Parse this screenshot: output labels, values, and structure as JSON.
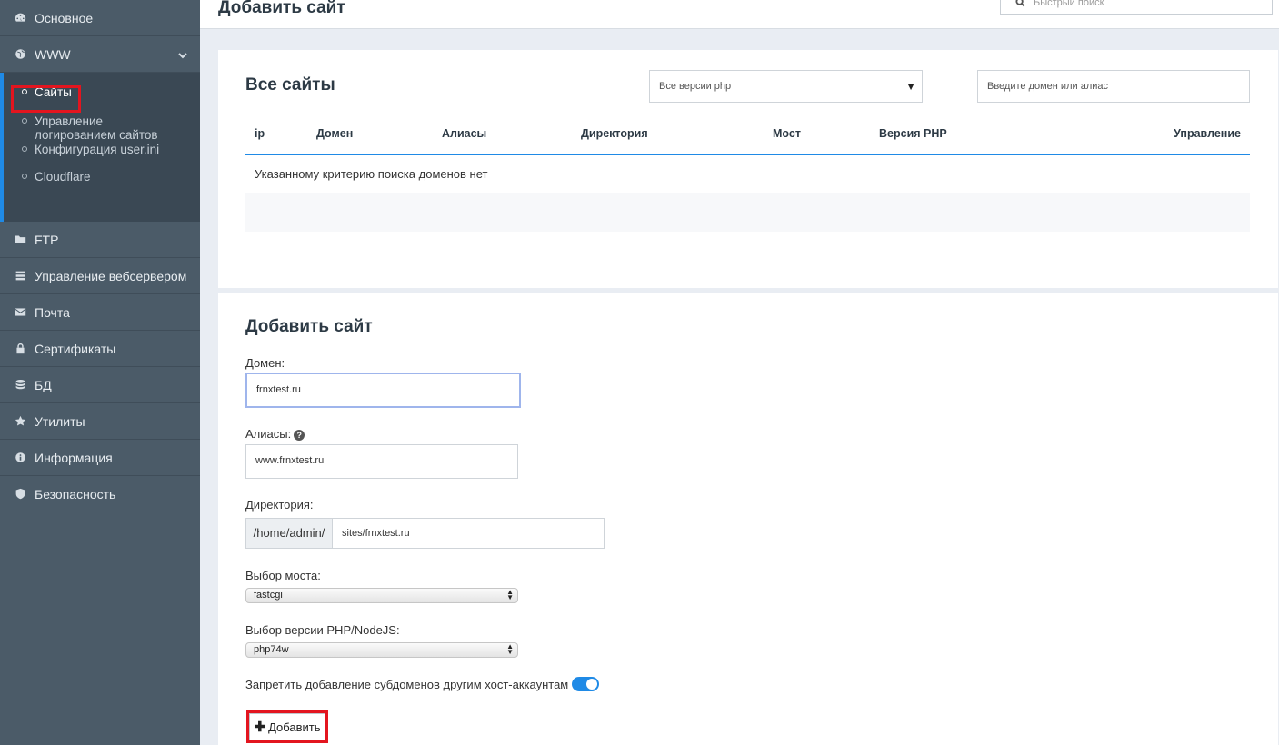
{
  "header": {
    "title": "Добавить сайт",
    "quick_search_placeholder": "Быстрый поиск"
  },
  "sidebar": {
    "items": [
      {
        "label": "Основное",
        "icon": "dashboard-icon"
      },
      {
        "label": "WWW",
        "icon": "globe-icon"
      },
      {
        "label": "FTP",
        "icon": "folder-icon"
      },
      {
        "label": "Управление вебсервером",
        "icon": "server-icon"
      },
      {
        "label": "Почта",
        "icon": "envelope-icon"
      },
      {
        "label": "Сертификаты",
        "icon": "lock-icon"
      },
      {
        "label": "БД",
        "icon": "database-icon"
      },
      {
        "label": "Утилиты",
        "icon": "star-icon"
      },
      {
        "label": "Информация",
        "icon": "info-icon"
      },
      {
        "label": "Безопасность",
        "icon": "shield-icon"
      }
    ],
    "www_submenu": [
      {
        "label": "Сайты",
        "active": true
      },
      {
        "label": "Управление логированием сайтов"
      },
      {
        "label": "Конфигурация user.ini"
      },
      {
        "label": "Cloudflare"
      }
    ]
  },
  "sites": {
    "title": "Все сайты",
    "php_filter": "Все версии php",
    "domain_filter_placeholder": "Введите домен или алиас",
    "columns": [
      "ip",
      "Домен",
      "Алиасы",
      "Директория",
      "Мост",
      "Версия PHP",
      "Управление"
    ],
    "empty_message": "Указанному критерию поиска доменов нет"
  },
  "form": {
    "title": "Добавить сайт",
    "domain_label": "Домен:",
    "domain_value": "frnxtest.ru",
    "aliases_label": "Алиасы:",
    "aliases_value": "www.frnxtest.ru",
    "directory_label": "Директория:",
    "directory_prefix": "/home/admin/",
    "directory_value": "sites/frnxtest.ru",
    "bridge_label": "Выбор моста:",
    "bridge_value": "fastcgi",
    "php_label": "Выбор версии PHP/NodeJS:",
    "php_value": "php74w",
    "subdomain_label": "Запретить добавление субдоменов другим хост-аккаунтам",
    "subdomain_enabled": true,
    "add_button": "Добавить",
    "help_glyph": "?"
  },
  "colors": {
    "sidebar_bg": "#4b5b68",
    "accent": "#1f8ae6",
    "highlight_red": "#e3151f"
  }
}
